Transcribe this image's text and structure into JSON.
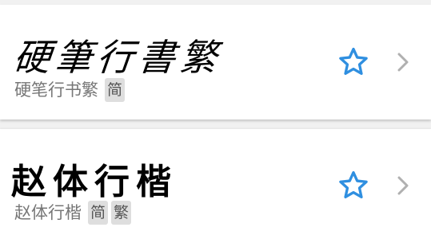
{
  "fonts": [
    {
      "preview_text": "硬筆行書繁",
      "name": "硬笔行书繁",
      "tags": [
        "简"
      ],
      "favorite_icon": "star-outline-icon",
      "open_icon": "chevron-right-icon"
    },
    {
      "preview_text": "赵体行楷",
      "name": "赵体行楷",
      "tags": [
        "简",
        "繁"
      ],
      "favorite_icon": "star-outline-icon",
      "open_icon": "chevron-right-icon"
    }
  ],
  "colors": {
    "star": "#2f8fe0",
    "chevron": "#b0b0b0",
    "name_text": "#777777",
    "tag_bg": "#dedede",
    "page_bg": "#f1f1f1"
  }
}
